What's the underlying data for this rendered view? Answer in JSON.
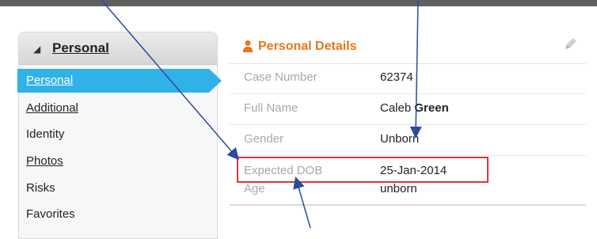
{
  "sidebar": {
    "header": "Personal",
    "items": [
      {
        "label": "Personal",
        "active": true
      },
      {
        "label": "Additional",
        "active": false
      },
      {
        "label": "Identity",
        "active": false
      },
      {
        "label": "Photos",
        "active": false
      },
      {
        "label": "Risks",
        "active": false
      },
      {
        "label": "Favorites",
        "active": false
      }
    ]
  },
  "details": {
    "title": "Personal Details",
    "fields": [
      {
        "label": "Case Number",
        "value": "62374"
      },
      {
        "label": "Full Name",
        "value_first": "Caleb",
        "value_last": "Green"
      },
      {
        "label": "Gender",
        "value": "Unborn"
      },
      {
        "label": "Expected DOB",
        "value": "25-Jan-2014"
      },
      {
        "label": "Age",
        "value": "unborn"
      }
    ]
  },
  "colors": {
    "accent_orange": "#e6761a",
    "nav_active": "#30b2e6",
    "highlight_red": "#d8373a",
    "arrow_blue": "#2a4a9a"
  },
  "icons": [
    "triangle-down-icon",
    "person-icon",
    "edit-pencil-icon"
  ]
}
